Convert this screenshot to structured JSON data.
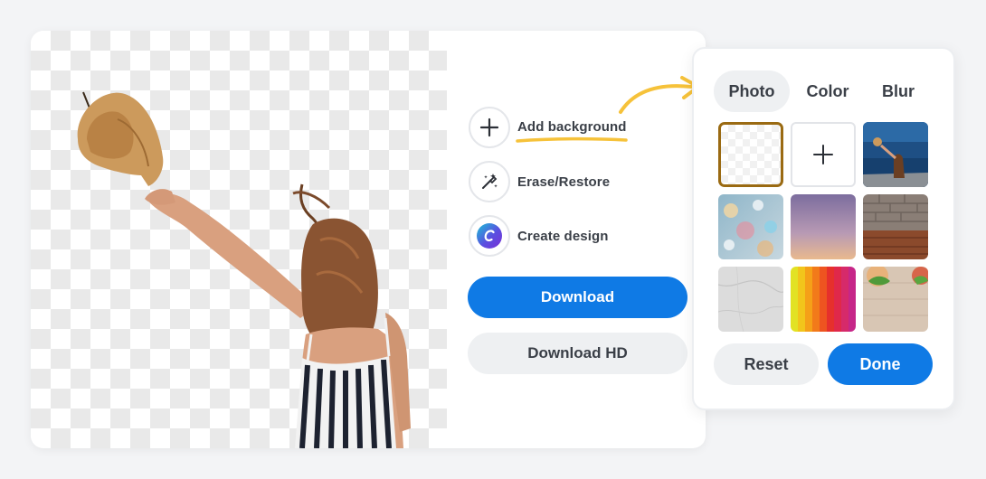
{
  "actions": {
    "add_background": "Add background",
    "erase_restore": "Erase/Restore",
    "create_design": "Create design"
  },
  "buttons": {
    "download": "Download",
    "download_hd": "Download HD"
  },
  "picker": {
    "tabs": [
      "Photo",
      "Color",
      "Blur"
    ],
    "active_tab": "Photo",
    "swatches": [
      "transparent",
      "add",
      "ocean-woman-photo",
      "bokeh-lights-photo",
      "purple-sunset-gradient",
      "brick-wood-photo",
      "marble-texture-photo",
      "rainbow-stripes-photo",
      "food-table-photo"
    ],
    "reset": "Reset",
    "done": "Done"
  },
  "colors": {
    "primary": "#0f7ae5",
    "highlight_underline": "#f6c23a",
    "selected_border": "#9a6a12"
  },
  "icons": {
    "add_background": "plus-icon",
    "erase_restore": "magic-brush-icon",
    "create_design": "canva-logo-icon",
    "arrow": "curved-arrow-icon"
  }
}
